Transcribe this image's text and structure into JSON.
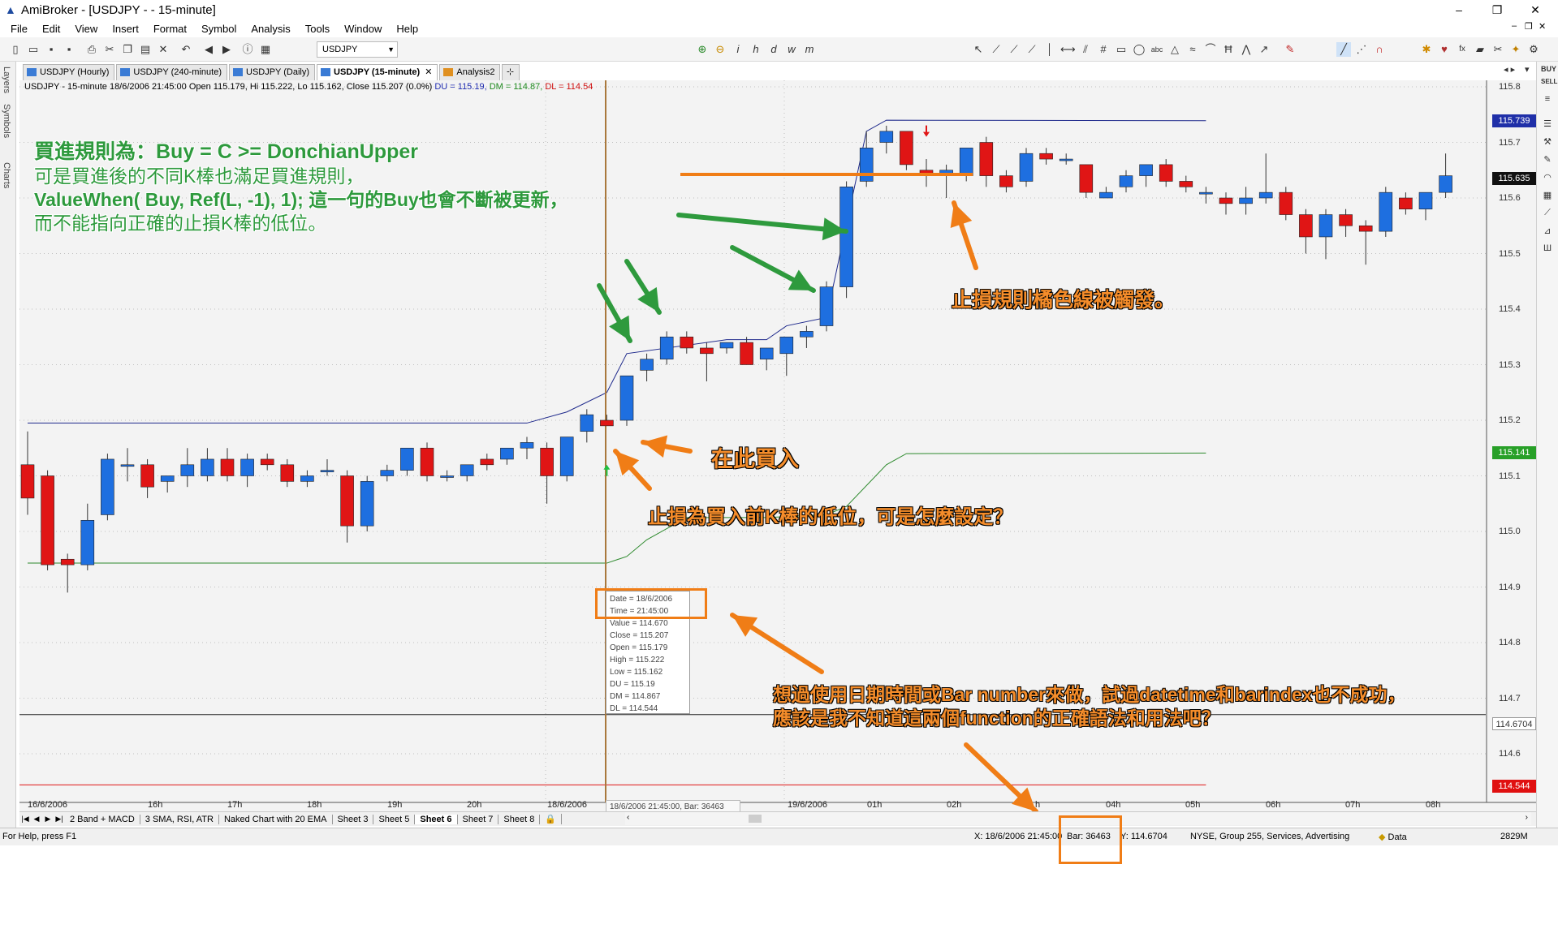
{
  "window": {
    "title": "AmiBroker - [USDJPY - - 15-minute]",
    "controls": [
      "–",
      "❐",
      "✕"
    ],
    "mdi_controls": [
      "–",
      "❐",
      "✕"
    ]
  },
  "menu": [
    "File",
    "Edit",
    "View",
    "Insert",
    "Format",
    "Symbol",
    "Analysis",
    "Tools",
    "Window",
    "Help"
  ],
  "toolbar": {
    "symbol_select": "USDJPY"
  },
  "left_dock": [
    "Layers",
    "Symbols",
    "Charts"
  ],
  "tabs": [
    {
      "label": "USDJPY (Hourly)",
      "active": false
    },
    {
      "label": "USDJPY (240-minute)",
      "active": false
    },
    {
      "label": "USDJPY (Daily)",
      "active": false
    },
    {
      "label": "USDJPY (15-minute)",
      "active": true
    },
    {
      "label": "Analysis2",
      "active": false
    }
  ],
  "chart": {
    "info_main": "USDJPY - 15-minute 18/6/2006 21:45:00 Open 115.179, Hi 115.222, Lo 115.162, Close 115.207 (0.0%)",
    "info_du": "DU = 115.19,",
    "info_dm": "DM = 114.87,",
    "info_dl": "DL = 114.54",
    "y_ticks": [
      "115.8",
      "115.7",
      "115.6",
      "115.5",
      "115.4",
      "115.3",
      "115.2",
      "115.1",
      "115.0",
      "114.9",
      "114.8",
      "114.7",
      "114.6"
    ],
    "price_boxes": [
      {
        "label": "115.739",
        "color": "#1f2fa8"
      },
      {
        "label": "115.635",
        "color": "#111111"
      },
      {
        "label": "115.141",
        "color": "#28a028"
      },
      {
        "label": "114.6704",
        "color": "#ffffff"
      },
      {
        "label": "114.544",
        "color": "#e01010"
      }
    ],
    "x_labels": [
      "16/6/2006",
      "16h",
      "17h",
      "18h",
      "19h",
      "20h",
      "18/6/2006",
      "19/6/2006",
      "01h",
      "02h",
      "h",
      "04h",
      "05h",
      "06h",
      "07h",
      "08h"
    ],
    "cursor_label": "18/6/2006 21:45:00, Bar: 36463",
    "colors": {
      "up": "#1e6fe0",
      "down": "#e01515",
      "du": "#1f2a8c",
      "dm": "#2d8a2d",
      "dl": "#e01515",
      "annotation": "#f07d16",
      "arrow_green": "#2e9a3d"
    }
  },
  "tooltip": {
    "lines": [
      "Date = 18/6/2006",
      "Time = 21:45:00",
      "Value = 114.670",
      "Close = 115.207",
      "Open = 115.179",
      "High = 115.222",
      "Low = 115.162",
      "DU = 115.19",
      "DM = 114.867",
      "DL = 114.544"
    ]
  },
  "annotations": {
    "rule_1": "買進規則為：Buy = C >= DonchianUpper",
    "rule_2": "可是買進後的不同K棒也滿足買進規則，",
    "rule_3": "ValueWhen( Buy, Ref(L, -1), 1); 這一句的Buy也會不斷被更新，",
    "rule_4": "而不能指向正確的止損K棒的低位。",
    "stop_triggered": "止損規則橘色線被觸發。",
    "buy_here": "在此買入",
    "stop_question": "止損為買入前K棒的低位，可是怎麼設定？",
    "datetime_1": "想過使用日期時間或Bar number來做，試過datetime和barindex也不成功，",
    "datetime_2": "應該是我不知道這兩個function的正確語法和用法吧？"
  },
  "sheets": [
    "2 Band + MACD",
    "3 SMA, RSI, ATR",
    "Naked Chart with 20 EMA",
    "Sheet 3",
    "Sheet 5",
    "Sheet 6",
    "Sheet 7",
    "Sheet 8"
  ],
  "active_sheet": "Sheet 6",
  "status": {
    "help": "For Help, press F1",
    "x_readout": "X: 18/6/2006 21:45:00",
    "bar_readout": "Bar: 36463",
    "y_readout": "Y: 114.6704",
    "symbol_info": "NYSE, Group 255, Services, Advertising",
    "data": "Data",
    "memory": "2829M"
  },
  "candles": [
    [
      115.12,
      115.18,
      115.03,
      115.06
    ],
    [
      115.1,
      115.11,
      114.93,
      114.94
    ],
    [
      114.95,
      114.96,
      114.89,
      114.94
    ],
    [
      114.94,
      115.05,
      114.93,
      115.02
    ],
    [
      115.03,
      115.14,
      115.02,
      115.13
    ],
    [
      115.12,
      115.15,
      115.09,
      115.12
    ],
    [
      115.12,
      115.13,
      115.06,
      115.08
    ],
    [
      115.09,
      115.1,
      115.07,
      115.1
    ],
    [
      115.1,
      115.15,
      115.08,
      115.12
    ],
    [
      115.1,
      115.15,
      115.09,
      115.13
    ],
    [
      115.13,
      115.15,
      115.09,
      115.1
    ],
    [
      115.1,
      115.14,
      115.08,
      115.13
    ],
    [
      115.13,
      115.14,
      115.11,
      115.12
    ],
    [
      115.12,
      115.13,
      115.08,
      115.09
    ],
    [
      115.09,
      115.11,
      115.08,
      115.1
    ],
    [
      115.11,
      115.13,
      115.1,
      115.11
    ],
    [
      115.1,
      115.11,
      114.98,
      115.01
    ],
    [
      115.01,
      115.1,
      115.0,
      115.09
    ],
    [
      115.1,
      115.12,
      115.09,
      115.11
    ],
    [
      115.11,
      115.14,
      115.1,
      115.15
    ],
    [
      115.15,
      115.16,
      115.09,
      115.1
    ],
    [
      115.1,
      115.11,
      115.09,
      115.1
    ],
    [
      115.1,
      115.12,
      115.09,
      115.12
    ],
    [
      115.13,
      115.14,
      115.11,
      115.12
    ],
    [
      115.13,
      115.14,
      115.12,
      115.15
    ],
    [
      115.15,
      115.17,
      115.13,
      115.16
    ],
    [
      115.15,
      115.16,
      115.05,
      115.1
    ],
    [
      115.1,
      115.17,
      115.09,
      115.17
    ],
    [
      115.18,
      115.22,
      115.16,
      115.21
    ],
    [
      115.2,
      115.21,
      115.19,
      115.19
    ],
    [
      115.2,
      115.28,
      115.19,
      115.28
    ],
    [
      115.29,
      115.32,
      115.27,
      115.31
    ],
    [
      115.31,
      115.36,
      115.3,
      115.35
    ],
    [
      115.35,
      115.36,
      115.32,
      115.33
    ],
    [
      115.33,
      115.34,
      115.27,
      115.32
    ],
    [
      115.33,
      115.34,
      115.32,
      115.34
    ],
    [
      115.34,
      115.35,
      115.3,
      115.3
    ],
    [
      115.31,
      115.33,
      115.29,
      115.33
    ],
    [
      115.32,
      115.35,
      115.28,
      115.35
    ],
    [
      115.35,
      115.37,
      115.33,
      115.36
    ],
    [
      115.37,
      115.45,
      115.36,
      115.44
    ],
    [
      115.44,
      115.63,
      115.42,
      115.62
    ],
    [
      115.63,
      115.72,
      115.62,
      115.69
    ],
    [
      115.7,
      115.73,
      115.68,
      115.72
    ],
    [
      115.72,
      115.72,
      115.65,
      115.66
    ],
    [
      115.65,
      115.67,
      115.62,
      115.64
    ],
    [
      115.64,
      115.66,
      115.6,
      115.65
    ],
    [
      115.64,
      115.69,
      115.63,
      115.69
    ],
    [
      115.7,
      115.71,
      115.62,
      115.64
    ],
    [
      115.64,
      115.65,
      115.61,
      115.62
    ],
    [
      115.63,
      115.69,
      115.62,
      115.68
    ],
    [
      115.68,
      115.69,
      115.66,
      115.67
    ],
    [
      115.67,
      115.68,
      115.66,
      115.67
    ],
    [
      115.66,
      115.66,
      115.6,
      115.61
    ],
    [
      115.6,
      115.62,
      115.6,
      115.61
    ],
    [
      115.62,
      115.65,
      115.61,
      115.64
    ],
    [
      115.64,
      115.66,
      115.62,
      115.66
    ],
    [
      115.66,
      115.67,
      115.62,
      115.63
    ],
    [
      115.63,
      115.64,
      115.61,
      115.62
    ],
    [
      115.61,
      115.62,
      115.59,
      115.61
    ],
    [
      115.6,
      115.61,
      115.57,
      115.59
    ],
    [
      115.59,
      115.62,
      115.57,
      115.6
    ],
    [
      115.6,
      115.68,
      115.59,
      115.61
    ],
    [
      115.61,
      115.62,
      115.56,
      115.57
    ],
    [
      115.57,
      115.58,
      115.5,
      115.53
    ],
    [
      115.53,
      115.58,
      115.49,
      115.57
    ],
    [
      115.57,
      115.58,
      115.53,
      115.55
    ],
    [
      115.55,
      115.56,
      115.48,
      115.54
    ],
    [
      115.54,
      115.62,
      115.53,
      115.61
    ],
    [
      115.6,
      115.61,
      115.57,
      115.58
    ],
    [
      115.58,
      115.61,
      115.56,
      115.61
    ],
    [
      115.61,
      115.68,
      115.6,
      115.64
    ]
  ]
}
